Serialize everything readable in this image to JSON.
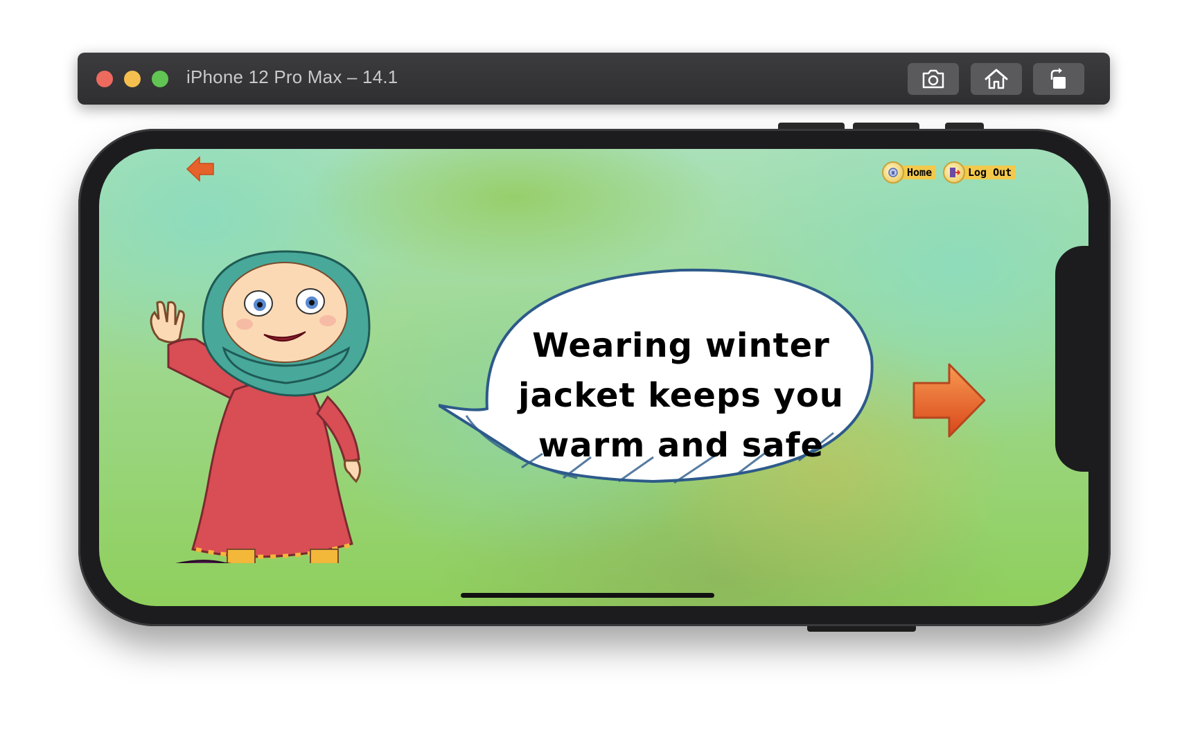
{
  "window": {
    "title": "iPhone 12 Pro Max – 14.1",
    "buttons": [
      {
        "icon": "screenshot-icon"
      },
      {
        "icon": "home-icon"
      },
      {
        "icon": "rotate-icon"
      }
    ]
  },
  "app": {
    "nav": {
      "home_label": "Home",
      "logout_label": "Log Out"
    },
    "message": "Wearing winter jacket keeps you warm and safe",
    "icons": {
      "back": "back-arrow-icon",
      "next": "next-arrow-icon"
    },
    "colors": {
      "arrow": "#e5632a",
      "pill": "#f2c94c"
    }
  }
}
